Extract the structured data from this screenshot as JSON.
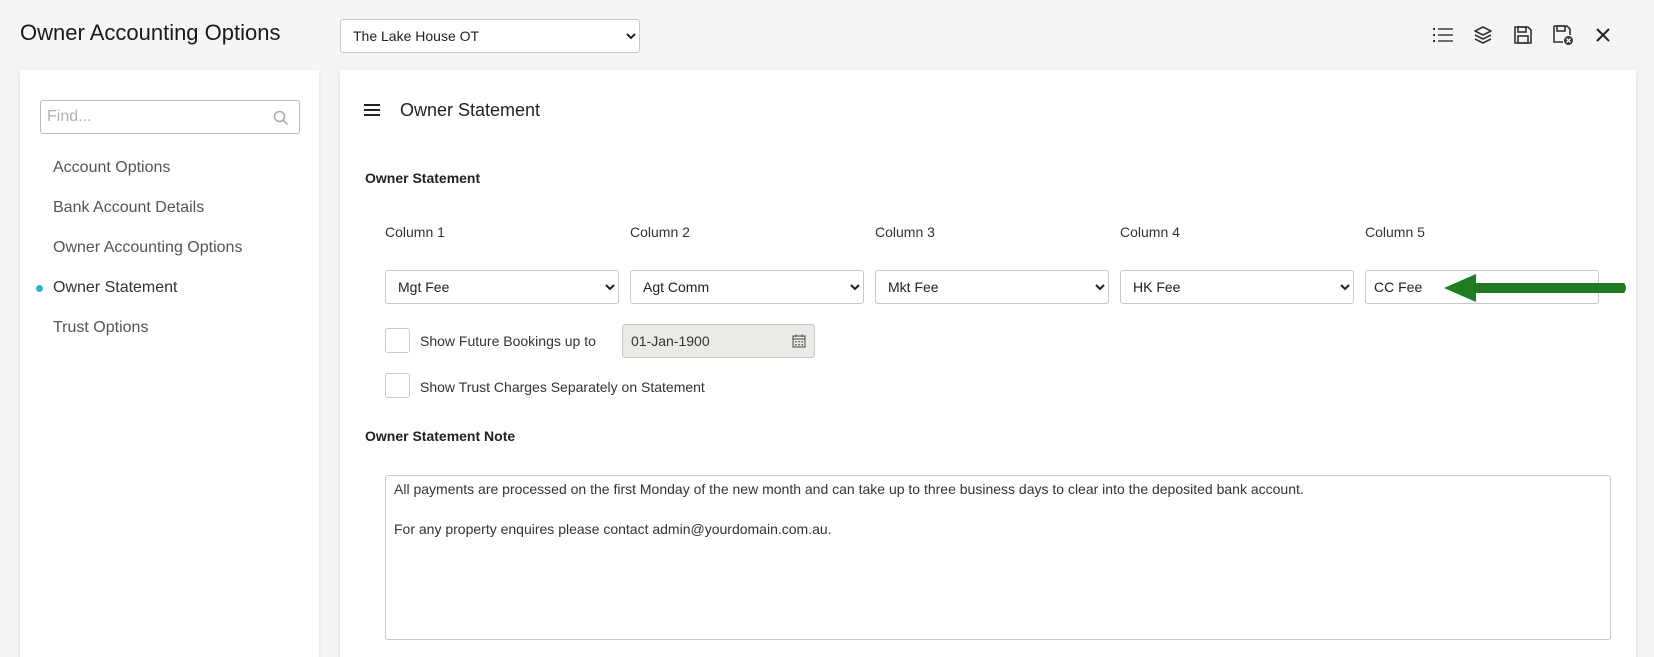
{
  "header": {
    "title": "Owner Accounting Options",
    "property_select": {
      "value": "The Lake House OT"
    }
  },
  "toolbar": {
    "icons": [
      "list-icon",
      "layers-icon",
      "save-icon",
      "save-and-close-icon",
      "close-icon"
    ]
  },
  "sidebar": {
    "search_placeholder": "Find...",
    "items": [
      {
        "label": "Account Options"
      },
      {
        "label": "Bank Account Details"
      },
      {
        "label": "Owner Accounting Options"
      },
      {
        "label": "Owner Statement",
        "active": true
      },
      {
        "label": "Trust Options"
      }
    ]
  },
  "panel": {
    "title": "Owner Statement",
    "section_title": "Owner Statement",
    "columns": [
      {
        "label": "Column 1",
        "value": "Mgt Fee"
      },
      {
        "label": "Column 2",
        "value": "Agt Comm"
      },
      {
        "label": "Column 3",
        "value": "Mkt Fee"
      },
      {
        "label": "Column 4",
        "value": "HK Fee"
      },
      {
        "label": "Column 5",
        "value": "CC Fee"
      }
    ],
    "future_bookings": {
      "label": "Show Future Bookings up to",
      "checked": false,
      "date": "01-Jan-1900"
    },
    "trust_charges": {
      "label": "Show Trust Charges Separately on Statement",
      "checked": false
    },
    "note_section_title": "Owner Statement Note",
    "note_lines": [
      "All payments are processed on the first Monday of the new month and can take up to three business days to clear into the deposited bank account.",
      "For any property enquires please contact admin@yourdomain.com.au."
    ]
  },
  "colors": {
    "accent": "#2bb3d8",
    "arrow": "#1f7a24"
  }
}
